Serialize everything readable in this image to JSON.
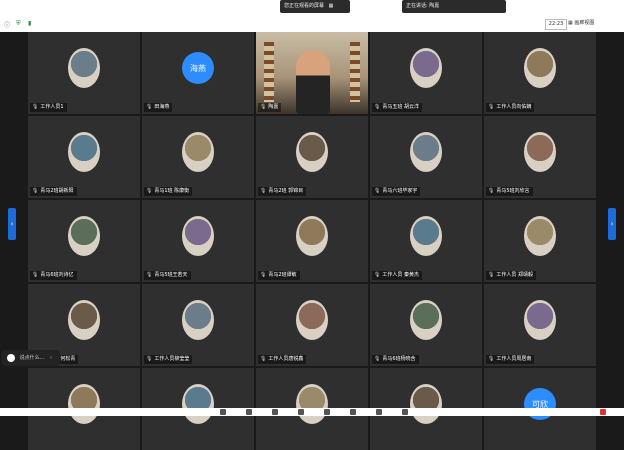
{
  "topbar": {
    "share_text": "您正在观看的屏幕",
    "speaking_text": "正在讲话: 陶嘉",
    "time": "22:23",
    "view_label": "画廊视图"
  },
  "chat": {
    "label": "说点什么..."
  },
  "tiles": [
    {
      "label": "工作人员1",
      "avatar": "photo"
    },
    {
      "label": "田海燕",
      "avatar": "text",
      "avatar_text": "海燕",
      "avatar_color": "#2d8cff"
    },
    {
      "label": "陶嘉",
      "avatar": "video"
    },
    {
      "label": "青马五班 胡云洋",
      "avatar": "photo"
    },
    {
      "label": "工作人员向佑嫡",
      "avatar": "photo"
    },
    {
      "label": "青马2班胡新阳",
      "avatar": "photo"
    },
    {
      "label": "青马1班 陈康衡",
      "avatar": "photo"
    },
    {
      "label": "青马2班 郭锦目",
      "avatar": "photo"
    },
    {
      "label": "青马六班毕家宇",
      "avatar": "photo"
    },
    {
      "label": "青马5班刘欣言",
      "avatar": "photo"
    },
    {
      "label": "青马6班刘诗亿",
      "avatar": "photo"
    },
    {
      "label": "青马5班王若天",
      "avatar": "photo"
    },
    {
      "label": "青马2班谭敏",
      "avatar": "photo"
    },
    {
      "label": "工作人员 秦黄杰",
      "avatar": "photo"
    },
    {
      "label": "工作人员 郑靖毅",
      "avatar": "photo"
    },
    {
      "label": "工作人员何松青",
      "avatar": "photo"
    },
    {
      "label": "工作人员柳莹莹",
      "avatar": "photo"
    },
    {
      "label": "工作人员唐锐鑫",
      "avatar": "photo"
    },
    {
      "label": "青马6班杨晓含",
      "avatar": "photo"
    },
    {
      "label": "工作人员周居南",
      "avatar": "photo"
    },
    {
      "label": "",
      "avatar": "photo"
    },
    {
      "label": "",
      "avatar": "photo"
    },
    {
      "label": "",
      "avatar": "photo"
    },
    {
      "label": "",
      "avatar": "photo"
    },
    {
      "label": "",
      "avatar": "text",
      "avatar_text": "可欣",
      "avatar_color": "#2d8cff"
    }
  ]
}
